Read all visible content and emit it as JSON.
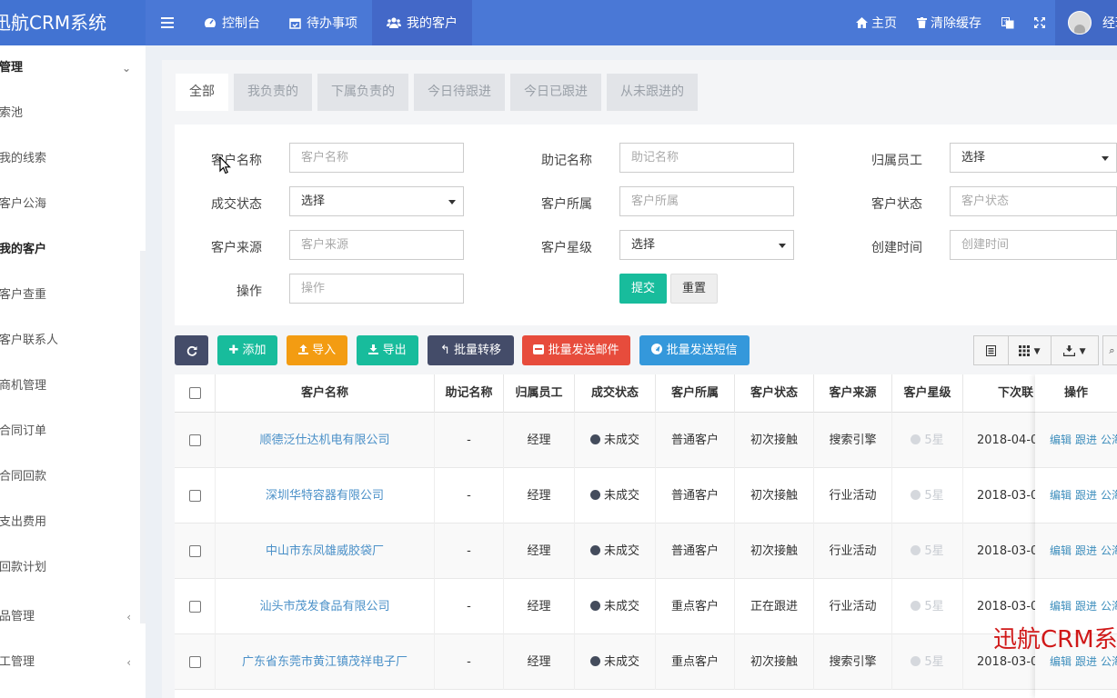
{
  "header": {
    "brand": "迅航CRM系统",
    "nav": [
      {
        "label": "控制台",
        "icon": "dashboard-icon"
      },
      {
        "label": "待办事项",
        "icon": "calendar-check-icon"
      },
      {
        "label": "我的客户",
        "icon": "users-icon"
      }
    ],
    "right": {
      "home": "主页",
      "clear_cache": "清除缓存",
      "user_name": "经理"
    }
  },
  "sidebar": {
    "group_title": "客户管理",
    "items": [
      {
        "label": "线索池"
      },
      {
        "label": "我的线索"
      },
      {
        "label": "客户公海"
      },
      {
        "label": "我的客户"
      },
      {
        "label": "客户查重"
      },
      {
        "label": "客户联系人"
      },
      {
        "label": "商机管理"
      },
      {
        "label": "合同订单"
      },
      {
        "label": "合同回款"
      },
      {
        "label": "支出费用"
      },
      {
        "label": "回款计划"
      }
    ],
    "groups_collapsed": [
      {
        "label": "产品管理"
      },
      {
        "label": "员工管理"
      }
    ]
  },
  "tabs": [
    "全部",
    "我负责的",
    "下属负责的",
    "今日待跟进",
    "今日已跟进",
    "从未跟进的"
  ],
  "filters": {
    "customer_name": {
      "label": "客户名称",
      "placeholder": "客户名称"
    },
    "mnemonic": {
      "label": "助记名称",
      "placeholder": "助记名称"
    },
    "owner": {
      "label": "归属员工",
      "value": "选择"
    },
    "deal_status": {
      "label": "成交状态",
      "value": "选择"
    },
    "belong": {
      "label": "客户所属",
      "placeholder": "客户所属"
    },
    "customer_status": {
      "label": "客户状态",
      "placeholder": "客户状态"
    },
    "source": {
      "label": "客户来源",
      "placeholder": "客户来源"
    },
    "rating": {
      "label": "客户星级",
      "value": "选择"
    },
    "created": {
      "label": "创建时间",
      "placeholder": "创建时间"
    },
    "operation": {
      "label": "操作",
      "placeholder": "操作"
    },
    "submit": "提交",
    "reset": "重置"
  },
  "toolbar": {
    "add": "添加",
    "import": "导入",
    "export": "导出",
    "batch_transfer": "批量转移",
    "batch_email": "批量发送邮件",
    "batch_sms": "批量发送短信"
  },
  "colors": {
    "topbar": "#4a78d6",
    "add": "#18bc9c",
    "import": "#f39c12",
    "export": "#18bc9c",
    "transfer": "#444c69",
    "email": "#e74c3c",
    "sms": "#3498db"
  },
  "table": {
    "headers": [
      "客户名称",
      "助记名称",
      "归属员工",
      "成交状态",
      "客户所属",
      "客户状态",
      "客户来源",
      "客户星级",
      "下次联",
      "操作"
    ],
    "rows": [
      {
        "name": "顺德泛仕达机电有限公司",
        "mnemonic": "-",
        "owner": "经理",
        "deal": "未成交",
        "belong": "普通客户",
        "status": "初次接触",
        "source": "搜索引擎",
        "stars": "5星",
        "next": "2018-04-0"
      },
      {
        "name": "深圳华特容器有限公司",
        "mnemonic": "-",
        "owner": "经理",
        "deal": "未成交",
        "belong": "普通客户",
        "status": "初次接触",
        "source": "行业活动",
        "stars": "5星",
        "next": "2018-03-0"
      },
      {
        "name": "中山市东凤雄威胶袋厂",
        "mnemonic": "-",
        "owner": "经理",
        "deal": "未成交",
        "belong": "普通客户",
        "status": "初次接触",
        "source": "行业活动",
        "stars": "5星",
        "next": "2018-03-0"
      },
      {
        "name": "汕头市茂发食品有限公司",
        "mnemonic": "-",
        "owner": "经理",
        "deal": "未成交",
        "belong": "重点客户",
        "status": "正在跟进",
        "source": "行业活动",
        "stars": "5星",
        "next": "2018-03-0"
      },
      {
        "name": "广东省东莞市黄江镇茂祥电子厂",
        "mnemonic": "-",
        "owner": "经理",
        "deal": "未成交",
        "belong": "重点客户",
        "status": "初次接触",
        "source": "搜索引擎",
        "stars": "5星",
        "next": "2018-03-0"
      }
    ],
    "row_ops": [
      "编辑",
      "跟进",
      "公海"
    ]
  },
  "watermark": "迅航CRM系统"
}
